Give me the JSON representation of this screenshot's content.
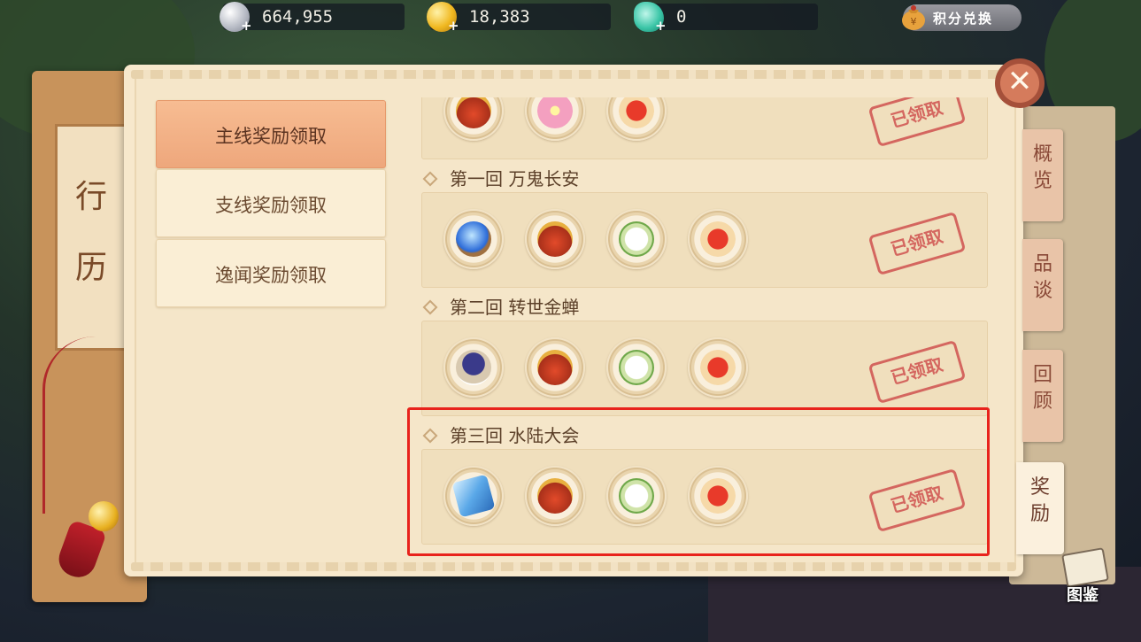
{
  "currencies": [
    {
      "icon": "silver-coin-icon",
      "value": "664,955",
      "plus": "+"
    },
    {
      "icon": "gold-coin-icon",
      "value": "18,383",
      "plus": "+"
    },
    {
      "icon": "jade-token-icon",
      "value": "0",
      "plus": "+"
    }
  ],
  "exchange": {
    "label": "积分兑换",
    "icon": "money-bag-icon"
  },
  "book": {
    "title_1": "行",
    "title_2": "历"
  },
  "menu": [
    {
      "label": "主线奖励领取",
      "active": true
    },
    {
      "label": "支线奖励领取",
      "active": false
    },
    {
      "label": "逸闻奖励领取",
      "active": false
    }
  ],
  "sections": [
    {
      "title": "",
      "items": [
        "lucky-bag-icon",
        "flower-icon",
        "red-soup-bowl-icon"
      ],
      "status": "已领取"
    },
    {
      "title": "第一回  万鬼长安",
      "items": [
        "crystal-orb-icon",
        "lucky-bag-icon",
        "white-lily-icon",
        "red-soup-bowl-icon"
      ],
      "status": "已领取"
    },
    {
      "title": "第二回  转世金蝉",
      "items": [
        "purple-bowl-icon",
        "lucky-bag-icon",
        "white-lily-icon",
        "red-soup-bowl-icon"
      ],
      "status": "已领取"
    },
    {
      "title": "第三回  水陆大会",
      "items": [
        "blue-scroll-icon",
        "lucky-bag-icon",
        "white-lily-icon",
        "red-soup-bowl-icon"
      ],
      "status": "已领取"
    }
  ],
  "side_tabs": [
    {
      "label": "概\n览",
      "active": false
    },
    {
      "label": "品\n谈",
      "active": false
    },
    {
      "label": "回\n顾",
      "active": false
    },
    {
      "label": "奖\n励",
      "active": true
    }
  ],
  "close": {
    "label": "✕"
  },
  "atlas": {
    "label": "图鉴"
  },
  "colors": {
    "highlight": "#e8231c",
    "active_menu": "#eea77c",
    "stamp": "#d25a55"
  }
}
